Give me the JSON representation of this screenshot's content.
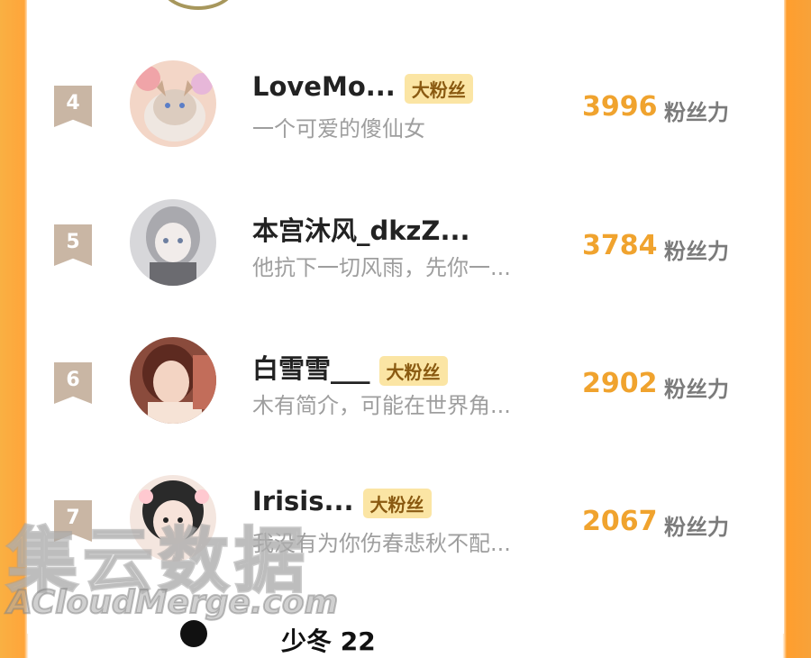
{
  "rows": [
    {
      "rank": "4",
      "name": "LoveMo...",
      "badge": "大粉丝",
      "bio": "一个可爱的傻仙女",
      "score": "3996",
      "unit": "粉丝力",
      "avatar": {
        "c1": "#e6c7b2",
        "c2": "#ffffff",
        "c3": "#f0a4a8"
      }
    },
    {
      "rank": "5",
      "name": "本宫沐风_dkzZ...",
      "badge": "",
      "bio": "他抗下一切风雨，先你一...",
      "score": "3784",
      "unit": "粉丝力",
      "avatar": {
        "c1": "#bfbfc2",
        "c2": "#e9e9ec",
        "c3": "#8a8a8f"
      }
    },
    {
      "rank": "6",
      "name": "白雪雪___",
      "badge": "大粉丝",
      "bio": "木有简介，可能在世界角...",
      "score": "2902",
      "unit": "粉丝力",
      "avatar": {
        "c1": "#b65b4a",
        "c2": "#f4d7c8",
        "c3": "#7a3328"
      }
    },
    {
      "rank": "7",
      "name": "Irisis...",
      "badge": "大粉丝",
      "bio": "我没有为你伤春悲秋不配...",
      "score": "2067",
      "unit": "粉丝力",
      "avatar": {
        "c1": "#2a2a2a",
        "c2": "#f6e1d8",
        "c3": "#ffc9d0"
      }
    }
  ],
  "next_row": {
    "name": "少冬 22"
  },
  "watermark": {
    "cn": "集云数据",
    "en": "ACloudMerge.com"
  }
}
